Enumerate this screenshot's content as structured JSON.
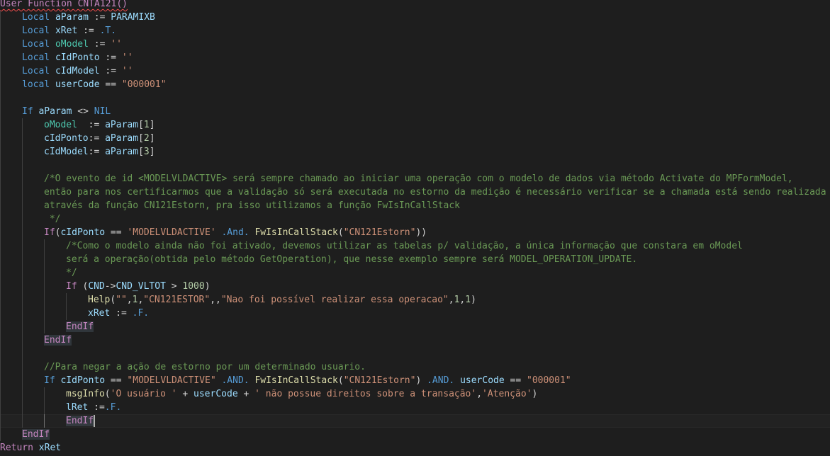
{
  "lines": [
    {
      "indent": 0,
      "tokens": [
        {
          "t": "User Function CNTA121()",
          "c": "kw squig"
        }
      ]
    },
    {
      "indent": 1,
      "tokens": [
        {
          "t": "Local",
          "c": "kw-local"
        },
        {
          "t": " "
        },
        {
          "t": "aParam",
          "c": "var"
        },
        {
          "t": " := "
        },
        {
          "t": "PARAMIXB",
          "c": "var"
        }
      ]
    },
    {
      "indent": 1,
      "tokens": [
        {
          "t": "Local",
          "c": "kw-local"
        },
        {
          "t": " "
        },
        {
          "t": "xRet",
          "c": "var"
        },
        {
          "t": " := "
        },
        {
          "t": ".T.",
          "c": "kw-local"
        }
      ]
    },
    {
      "indent": 1,
      "tokens": [
        {
          "t": "Local",
          "c": "kw-local"
        },
        {
          "t": " "
        },
        {
          "t": "oModel",
          "c": "var-g"
        },
        {
          "t": " := "
        },
        {
          "t": "''",
          "c": "str"
        }
      ]
    },
    {
      "indent": 1,
      "tokens": [
        {
          "t": "Local",
          "c": "kw-local"
        },
        {
          "t": " "
        },
        {
          "t": "cIdPonto",
          "c": "var"
        },
        {
          "t": " := "
        },
        {
          "t": "''",
          "c": "str"
        }
      ]
    },
    {
      "indent": 1,
      "tokens": [
        {
          "t": "Local",
          "c": "kw-local"
        },
        {
          "t": " "
        },
        {
          "t": "cIdModel",
          "c": "var"
        },
        {
          "t": " := "
        },
        {
          "t": "''",
          "c": "str"
        }
      ]
    },
    {
      "indent": 1,
      "tokens": [
        {
          "t": "local",
          "c": "kw-local"
        },
        {
          "t": " "
        },
        {
          "t": "userCode",
          "c": "var"
        },
        {
          "t": " == "
        },
        {
          "t": "\"000001\"",
          "c": "str"
        }
      ]
    },
    {
      "indent": 0,
      "tokens": []
    },
    {
      "indent": 1,
      "tokens": [
        {
          "t": "If",
          "c": "kw-local"
        },
        {
          "t": " "
        },
        {
          "t": "aParam",
          "c": "var"
        },
        {
          "t": " <> "
        },
        {
          "t": "NIL",
          "c": "kw-local"
        }
      ]
    },
    {
      "indent": 2,
      "tokens": [
        {
          "t": "oModel",
          "c": "var-g"
        },
        {
          "t": "  := "
        },
        {
          "t": "aParam",
          "c": "var"
        },
        {
          "t": "["
        },
        {
          "t": "1",
          "c": "num"
        },
        {
          "t": "]"
        }
      ]
    },
    {
      "indent": 2,
      "tokens": [
        {
          "t": "cIdPonto",
          "c": "var"
        },
        {
          "t": ":= "
        },
        {
          "t": "aParam",
          "c": "var"
        },
        {
          "t": "["
        },
        {
          "t": "2",
          "c": "num"
        },
        {
          "t": "]"
        }
      ]
    },
    {
      "indent": 2,
      "tokens": [
        {
          "t": "cIdModel",
          "c": "var"
        },
        {
          "t": ":= "
        },
        {
          "t": "aParam",
          "c": "var"
        },
        {
          "t": "["
        },
        {
          "t": "3",
          "c": "num"
        },
        {
          "t": "]"
        }
      ]
    },
    {
      "indent": 0,
      "tokens": []
    },
    {
      "indent": 2,
      "tokens": [
        {
          "t": "/*O evento de id <MODELVLDACTIVE> será sempre chamado ao iniciar uma operação com o modelo de dados via método Activate do MPFormModel,",
          "c": "cmt"
        }
      ]
    },
    {
      "indent": 2,
      "tokens": [
        {
          "t": "então para nos certificarmos que a validação só será executada no estorno da medição é necessário verificar se a chamada está sendo realizada",
          "c": "cmt"
        }
      ]
    },
    {
      "indent": 2,
      "tokens": [
        {
          "t": "através da função CN121Estorn, pra isso utilizamos a função FwIsInCallStack",
          "c": "cmt"
        }
      ]
    },
    {
      "indent": 2,
      "tokens": [
        {
          "t": " */",
          "c": "cmt"
        }
      ]
    },
    {
      "indent": 2,
      "tokens": [
        {
          "t": "If",
          "c": "kw"
        },
        {
          "t": "("
        },
        {
          "t": "cIdPonto",
          "c": "var"
        },
        {
          "t": " == "
        },
        {
          "t": "'MODELVLDACTIVE'",
          "c": "str"
        },
        {
          "t": " "
        },
        {
          "t": ".And.",
          "c": "kw-local"
        },
        {
          "t": " "
        },
        {
          "t": "FwIsInCallStack",
          "c": "fn"
        },
        {
          "t": "("
        },
        {
          "t": "\"CN121Estorn\"",
          "c": "str"
        },
        {
          "t": "))"
        }
      ]
    },
    {
      "indent": 3,
      "tokens": [
        {
          "t": "/*Como o modelo ainda não foi ativado, devemos utilizar as tabelas p/ validação, a única informação que constara em oModel",
          "c": "cmt"
        }
      ]
    },
    {
      "indent": 3,
      "tokens": [
        {
          "t": "será a operação(obtida pelo método GetOperation), que nesse exemplo sempre será MODEL_OPERATION_UPDATE.",
          "c": "cmt"
        }
      ]
    },
    {
      "indent": 3,
      "tokens": [
        {
          "t": "*/",
          "c": "cmt"
        }
      ]
    },
    {
      "indent": 3,
      "tokens": [
        {
          "t": "If",
          "c": "kw"
        },
        {
          "t": " ("
        },
        {
          "t": "CND",
          "c": "var"
        },
        {
          "t": "->"
        },
        {
          "t": "CND_VLTOT",
          "c": "var"
        },
        {
          "t": " > "
        },
        {
          "t": "1000",
          "c": "num"
        },
        {
          "t": ")"
        }
      ]
    },
    {
      "indent": 4,
      "tokens": [
        {
          "t": "Help",
          "c": "fn"
        },
        {
          "t": "("
        },
        {
          "t": "\"\"",
          "c": "str"
        },
        {
          "t": ","
        },
        {
          "t": "1",
          "c": "num"
        },
        {
          "t": ","
        },
        {
          "t": "\"CN121ESTOR\"",
          "c": "str"
        },
        {
          "t": ",,"
        },
        {
          "t": "\"Nao foi possível realizar essa operacao\"",
          "c": "str"
        },
        {
          "t": ","
        },
        {
          "t": "1",
          "c": "num"
        },
        {
          "t": ","
        },
        {
          "t": "1",
          "c": "num"
        },
        {
          "t": ")"
        }
      ]
    },
    {
      "indent": 4,
      "tokens": [
        {
          "t": "xRet",
          "c": "var"
        },
        {
          "t": " := "
        },
        {
          "t": ".F.",
          "c": "kw-local"
        }
      ]
    },
    {
      "indent": 3,
      "tokens": [
        {
          "t": "EndIf",
          "c": "kw-hl"
        }
      ]
    },
    {
      "indent": 2,
      "tokens": [
        {
          "t": "EndIf",
          "c": "kw-hl"
        }
      ]
    },
    {
      "indent": 0,
      "tokens": []
    },
    {
      "indent": 2,
      "tokens": [
        {
          "t": "//Para negar a ação de estorno por um determinado usuario.",
          "c": "cmt"
        }
      ]
    },
    {
      "indent": 2,
      "tokens": [
        {
          "t": "If",
          "c": "kw-local"
        },
        {
          "t": " "
        },
        {
          "t": "cIdPonto",
          "c": "var"
        },
        {
          "t": " == "
        },
        {
          "t": "\"MODELVLDACTIVE\"",
          "c": "str"
        },
        {
          "t": " "
        },
        {
          "t": ".AND.",
          "c": "kw-local"
        },
        {
          "t": " "
        },
        {
          "t": "FwIsInCallStack",
          "c": "fn"
        },
        {
          "t": "("
        },
        {
          "t": "\"CN121Estorn\"",
          "c": "str"
        },
        {
          "t": ") "
        },
        {
          "t": ".AND.",
          "c": "kw-local"
        },
        {
          "t": " "
        },
        {
          "t": "userCode",
          "c": "var"
        },
        {
          "t": " == "
        },
        {
          "t": "\"000001\"",
          "c": "str"
        }
      ]
    },
    {
      "indent": 3,
      "tokens": [
        {
          "t": "msgInfo",
          "c": "fn"
        },
        {
          "t": "("
        },
        {
          "t": "'O usuário '",
          "c": "str"
        },
        {
          "t": " + "
        },
        {
          "t": "userCode",
          "c": "var"
        },
        {
          "t": " + "
        },
        {
          "t": "' não possue direitos sobre a transação'",
          "c": "str"
        },
        {
          "t": ","
        },
        {
          "t": "'Atenção'",
          "c": "str"
        },
        {
          "t": ")"
        }
      ]
    },
    {
      "indent": 3,
      "tokens": [
        {
          "t": "lRet",
          "c": "var"
        },
        {
          "t": " :="
        },
        {
          "t": ".F.",
          "c": "kw-local"
        }
      ]
    },
    {
      "indent": 3,
      "tokens": [
        {
          "t": "EndIf",
          "c": "kw-hl"
        }
      ],
      "cursor": true,
      "current": true
    },
    {
      "indent": 1,
      "tokens": [
        {
          "t": "EndIf",
          "c": "kw-hl"
        }
      ]
    },
    {
      "indent": 0,
      "tokens": [
        {
          "t": "Return",
          "c": "kw"
        },
        {
          "t": " "
        },
        {
          "t": "xRet",
          "c": "var"
        }
      ]
    }
  ],
  "colors": {
    "background": "#1e1e1e",
    "keyword": "#c586c0",
    "storage": "#569cd6",
    "variable": "#9cdcfe",
    "function": "#dcdcaa",
    "string": "#ce9178",
    "number": "#b5cea8",
    "comment": "#6a9955"
  }
}
